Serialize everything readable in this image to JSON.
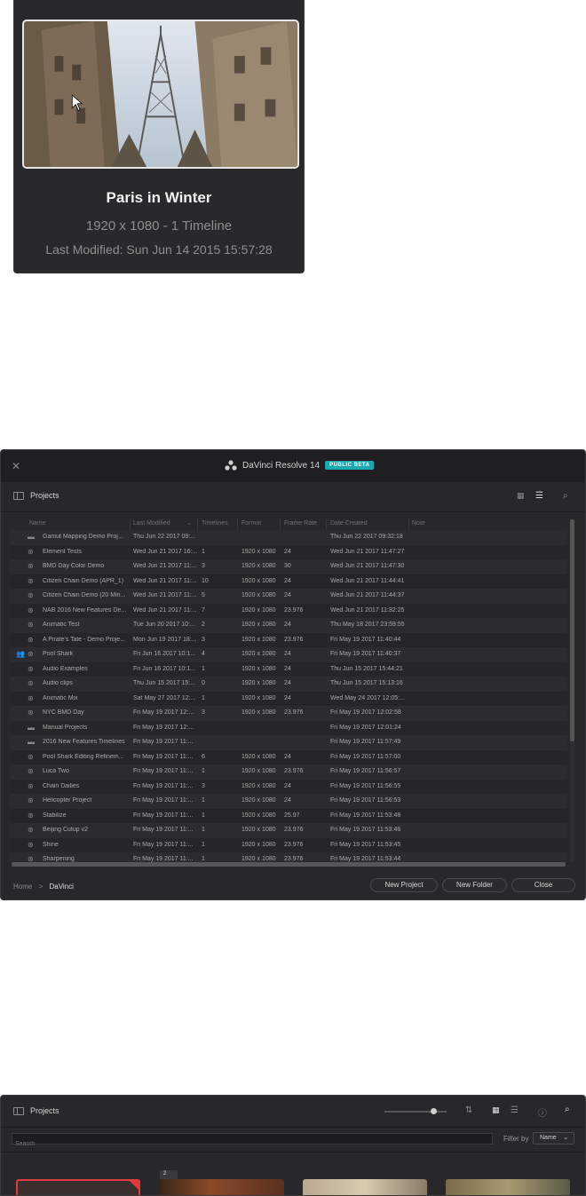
{
  "card": {
    "title": "Paris in Winter",
    "subtitle": "1920 x 1080 - 1 Timeline",
    "modified": "Last Modified: Sun Jun 14 2015 15:57:28"
  },
  "manager": {
    "app_name": "DaVinci Resolve 14",
    "beta_badge": "PUBLIC BETA",
    "panel_title": "Projects",
    "columns": [
      "Name",
      "Last Modified",
      "Timelines",
      "Format",
      "Frame Rate",
      "Date Created",
      "Note"
    ],
    "rows": [
      {
        "icon": "folder",
        "name": "Gamut Mapping Demo Proj...",
        "modified": "Thu Jun 22 2017 09:...",
        "timelines": "",
        "format": "",
        "fps": "",
        "created": "Thu Jun 22 2017 09:32:18"
      },
      {
        "icon": "resolve",
        "name": "Element Tests",
        "modified": "Wed Jun 21 2017 16:...",
        "timelines": "1",
        "format": "1920 x 1080",
        "fps": "24",
        "created": "Wed Jun 21 2017 11:47:27"
      },
      {
        "icon": "resolve",
        "name": "BMD Day Color Demo",
        "modified": "Wed Jun 21 2017 11:...",
        "timelines": "3",
        "format": "1920 x 1080",
        "fps": "30",
        "created": "Wed Jun 21 2017 11:47:30"
      },
      {
        "icon": "resolve",
        "name": "Citizen Chain Demo (APR_1)",
        "modified": "Wed Jun 21 2017 11:...",
        "timelines": "10",
        "format": "1920 x 1080",
        "fps": "24",
        "created": "Wed Jun 21 2017 11:44:41"
      },
      {
        "icon": "resolve",
        "name": "Citizen Chain Demo (20 Min...",
        "modified": "Wed Jun 21 2017 11:...",
        "timelines": "5",
        "format": "1920 x 1080",
        "fps": "24",
        "created": "Wed Jun 21 2017 11:44:37"
      },
      {
        "icon": "resolve",
        "name": "NAB 2016 New Features De...",
        "modified": "Wed Jun 21 2017 11:...",
        "timelines": "7",
        "format": "1920 x 1080",
        "fps": "23.976",
        "created": "Wed Jun 21 2017 11:32:25"
      },
      {
        "icon": "resolve",
        "name": "Animatic Test",
        "modified": "Tue Jun 20 2017 10:...",
        "timelines": "2",
        "format": "1920 x 1080",
        "fps": "24",
        "created": "Thu May 18 2017 23:59:55"
      },
      {
        "icon": "resolve",
        "name": "A Pirate's Tale - Demo Proje...",
        "modified": "Mon Jun 19 2017 18:...",
        "timelines": "3",
        "format": "1920 x 1080",
        "fps": "23.976",
        "created": "Fri May 19 2017 11:40:44"
      },
      {
        "icon": "resolve",
        "collab": true,
        "name": "Pool Shark",
        "modified": "Fri Jun 16 2017 10:1...",
        "timelines": "4",
        "format": "1920 x 1080",
        "fps": "24",
        "created": "Fri May 19 2017 11:40:37"
      },
      {
        "icon": "resolve",
        "name": "Audio Examples",
        "modified": "Fri Jun 16 2017 10:1...",
        "timelines": "1",
        "format": "1920 x 1080",
        "fps": "24",
        "created": "Thu Jun 15 2017 15:44:21"
      },
      {
        "icon": "resolve",
        "name": "Audio clips",
        "modified": "Thu Jun 15 2017 15:...",
        "timelines": "0",
        "format": "1920 x 1080",
        "fps": "24",
        "created": "Thu Jun 15 2017 15:13:16"
      },
      {
        "icon": "resolve",
        "name": "Animatic Mix",
        "modified": "Sat May 27 2017 12:...",
        "timelines": "1",
        "format": "1920 x 1080",
        "fps": "24",
        "created": "Wed May 24 2017 12:05:..."
      },
      {
        "icon": "resolve",
        "name": "NYC BMD Day",
        "modified": "Fri May 19 2017 12:...",
        "timelines": "3",
        "format": "1920 x 1080",
        "fps": "23.976",
        "created": "Fri May 19 2017 12:02:58"
      },
      {
        "icon": "folder",
        "name": "Manual Projects",
        "modified": "Fri May 19 2017 12:...",
        "timelines": "",
        "format": "",
        "fps": "",
        "created": "Fri May 19 2017 12:01:24"
      },
      {
        "icon": "folder",
        "name": "2016 New Features Timelines",
        "modified": "Fri May 19 2017 11:...",
        "timelines": "",
        "format": "",
        "fps": "",
        "created": "Fri May 19 2017 11:57:49"
      },
      {
        "icon": "resolve",
        "name": "Pool Shark Editing Refinem...",
        "modified": "Fri May 19 2017 11:...",
        "timelines": "6",
        "format": "1920 x 1080",
        "fps": "24",
        "created": "Fri May 19 2017 11:57:00"
      },
      {
        "icon": "resolve",
        "name": "Luca Two",
        "modified": "Fri May 19 2017 11:...",
        "timelines": "1",
        "format": "1920 x 1080",
        "fps": "23.976",
        "created": "Fri May 19 2017 11:56:57"
      },
      {
        "icon": "resolve",
        "name": "Chain Dailies",
        "modified": "Fri May 19 2017 11:...",
        "timelines": "3",
        "format": "1920 x 1080",
        "fps": "24",
        "created": "Fri May 19 2017 11:56:55"
      },
      {
        "icon": "resolve",
        "name": "Helicopter Project",
        "modified": "Fri May 19 2017 11:...",
        "timelines": "1",
        "format": "1920 x 1080",
        "fps": "24",
        "created": "Fri May 19 2017 11:56:53"
      },
      {
        "icon": "resolve",
        "name": "Stabilize",
        "modified": "Fri May 19 2017 11:...",
        "timelines": "1",
        "format": "1920 x 1080",
        "fps": "25.97",
        "created": "Fri May 19 2017 11:53:48"
      },
      {
        "icon": "resolve",
        "name": "Beijing Cutup v2",
        "modified": "Fri May 19 2017 11:...",
        "timelines": "1",
        "format": "1920 x 1080",
        "fps": "23.976",
        "created": "Fri May 19 2017 11:53:46"
      },
      {
        "icon": "resolve",
        "name": "Shine",
        "modified": "Fri May 19 2017 11:...",
        "timelines": "1",
        "format": "1920 x 1080",
        "fps": "23.976",
        "created": "Fri May 19 2017 11:53:45"
      },
      {
        "icon": "resolve",
        "name": "Sharpening",
        "modified": "Fri May 19 2017 11:...",
        "timelines": "1",
        "format": "1920 x 1080",
        "fps": "23.976",
        "created": "Fri May 19 2017 11:53:44"
      }
    ],
    "breadcrumb": {
      "home": "Home",
      "separator": ">",
      "current": "DaVinci"
    },
    "buttons": {
      "new_project": "New Project",
      "new_folder": "New Folder",
      "close": "Close"
    }
  },
  "thumbs": {
    "panel_title": "Projects",
    "search_placeholder": "Search",
    "filter_label": "Filter by",
    "filter_value": "Name",
    "badge": "2"
  },
  "colors": {
    "accent": "#1aa8b3",
    "window_bg": "#28282b",
    "selected_red": "#e03a3a"
  }
}
